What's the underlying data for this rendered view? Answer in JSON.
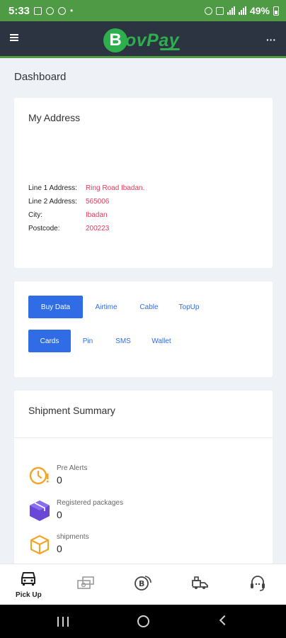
{
  "status_bar": {
    "time": "5:33",
    "battery": "49%"
  },
  "header": {
    "logo_letter": "B",
    "logo_text": "ovPay"
  },
  "page": {
    "title": "Dashboard"
  },
  "address_card": {
    "title": "My Address",
    "rows": [
      {
        "label": "Line 1 Address:",
        "value": "Ring Road Ibadan."
      },
      {
        "label": "Line 2 Address:",
        "value": "565006"
      },
      {
        "label": "City:",
        "value": "Ibadan"
      },
      {
        "label": "Postcode:",
        "value": "200223"
      }
    ]
  },
  "services": {
    "row1": [
      {
        "label": "Buy Data",
        "active": true
      },
      {
        "label": "Airtime",
        "active": false
      },
      {
        "label": "Cable",
        "active": false
      },
      {
        "label": "TopUp",
        "active": false
      }
    ],
    "row2": [
      {
        "label": "Cards",
        "active": true
      },
      {
        "label": "Pin",
        "active": false
      },
      {
        "label": "SMS",
        "active": false
      },
      {
        "label": "Wallet",
        "active": false
      }
    ]
  },
  "shipment_summary": {
    "title": "Shipment Summary",
    "items": [
      {
        "label": "Pre Alerts",
        "count": "0",
        "icon": "clock-alert-icon"
      },
      {
        "label": "Registered packages",
        "count": "0",
        "icon": "package-box-icon"
      },
      {
        "label": "shipments",
        "count": "0",
        "icon": "shipment-box-icon"
      }
    ]
  },
  "bottom_nav": {
    "items": [
      {
        "label": "Pick Up",
        "icon": "car-pickup-icon"
      },
      {
        "label": "",
        "icon": "payment-icon"
      },
      {
        "label": "",
        "icon": "crypto-coin-icon"
      },
      {
        "label": "",
        "icon": "delivery-truck-icon"
      },
      {
        "label": "",
        "icon": "headset-support-icon"
      }
    ]
  },
  "colors": {
    "accent": "#2f6ce6",
    "brand_green": "#2eaf4e",
    "status_green": "#4e9a45",
    "header_dark": "#2b3440",
    "value_red": "#e8385b",
    "alert_orange": "#f2a52b",
    "package_purple": "#6a48d6"
  }
}
